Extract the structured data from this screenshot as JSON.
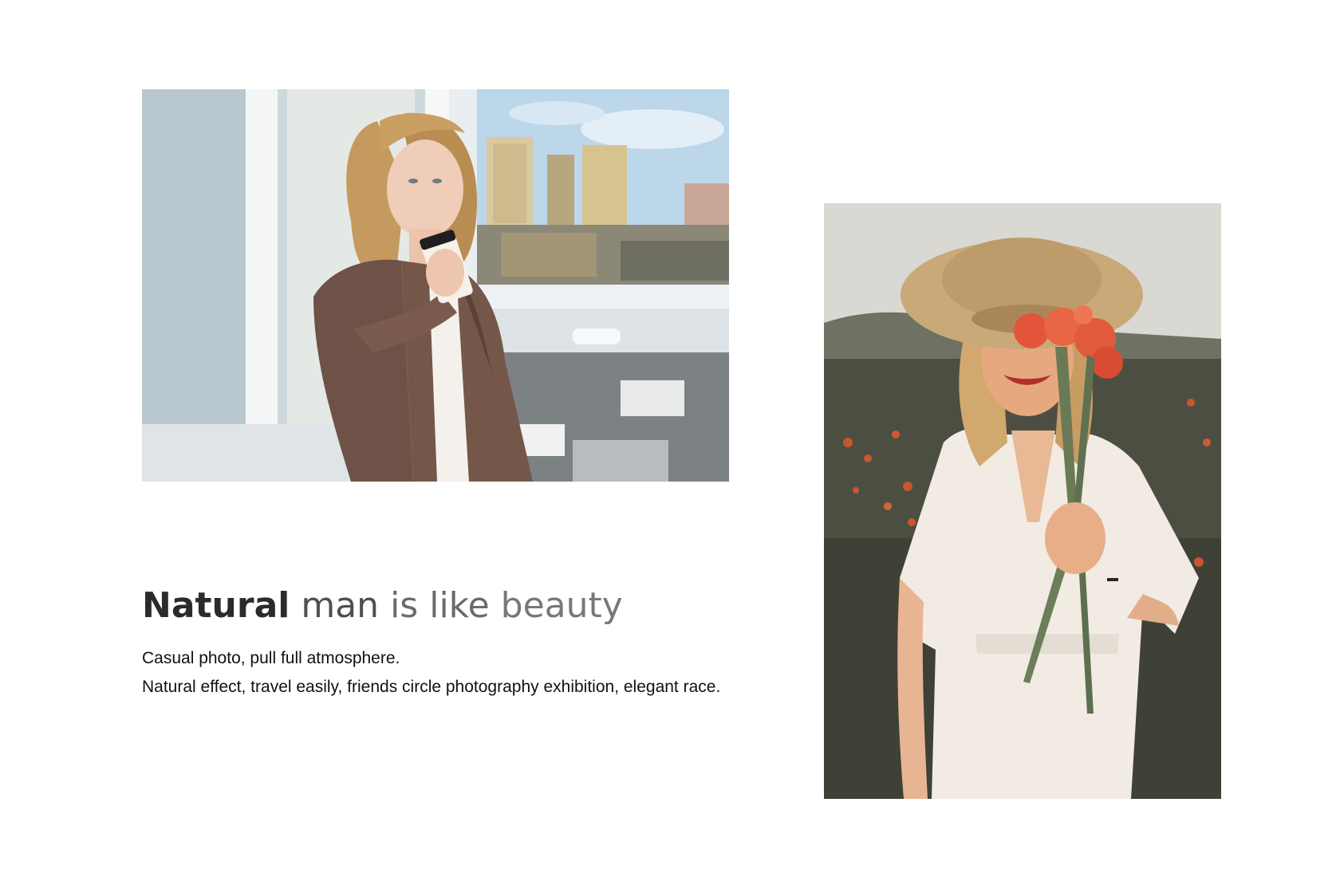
{
  "headline": {
    "part1": "Natural",
    "part2": "man",
    "part3": "is like",
    "part4": "beauty"
  },
  "body": {
    "line1": "Casual photo, pull full atmosphere.",
    "line2": "Natural effect, travel easily, friends circle photography exhibition, elegant race."
  },
  "images": {
    "photo1": "woman-drinking-coffee-by-window",
    "photo2": "smiling-woman-in-straw-hat-holding-poppies"
  },
  "colors": {
    "background": "#ffffff",
    "headline_dark": "#2b2b2b",
    "headline_light": "#787878",
    "body_text": "#111111"
  }
}
